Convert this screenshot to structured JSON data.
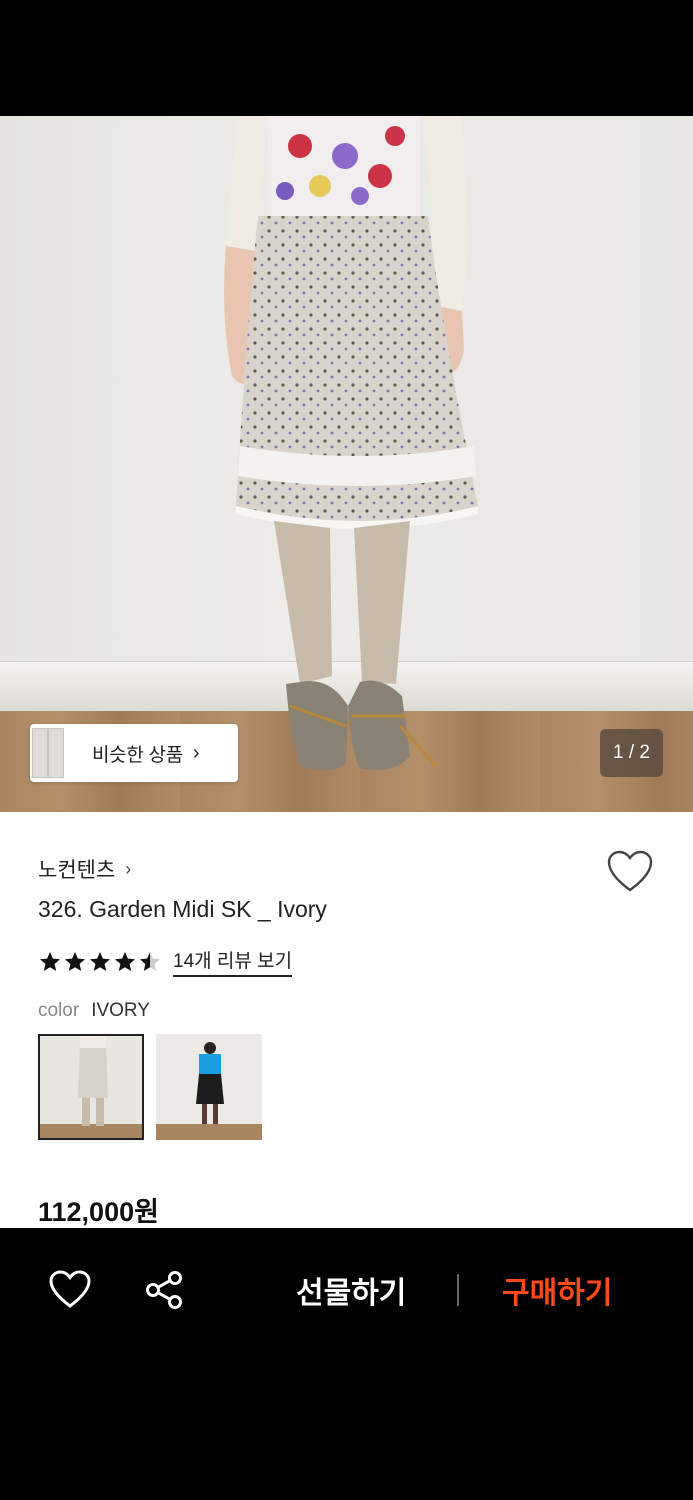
{
  "gallery": {
    "similar_label": "비슷한 상품",
    "similar_arrow": "›",
    "page_indicator": "1 / 2"
  },
  "product": {
    "brand": "노컨텐츠",
    "brand_chevron": "›",
    "title": "326. Garden Midi SK _ Ivory",
    "rating": 4.5,
    "review_link": "14개 리뷰 보기",
    "color_label": "color",
    "color_value": "IVORY",
    "price": "112,000원"
  },
  "actions": {
    "gift_label": "선물하기",
    "buy_label": "구매하기"
  },
  "colors": {
    "buy_accent": "#ff4a1a",
    "star": "#111111"
  }
}
